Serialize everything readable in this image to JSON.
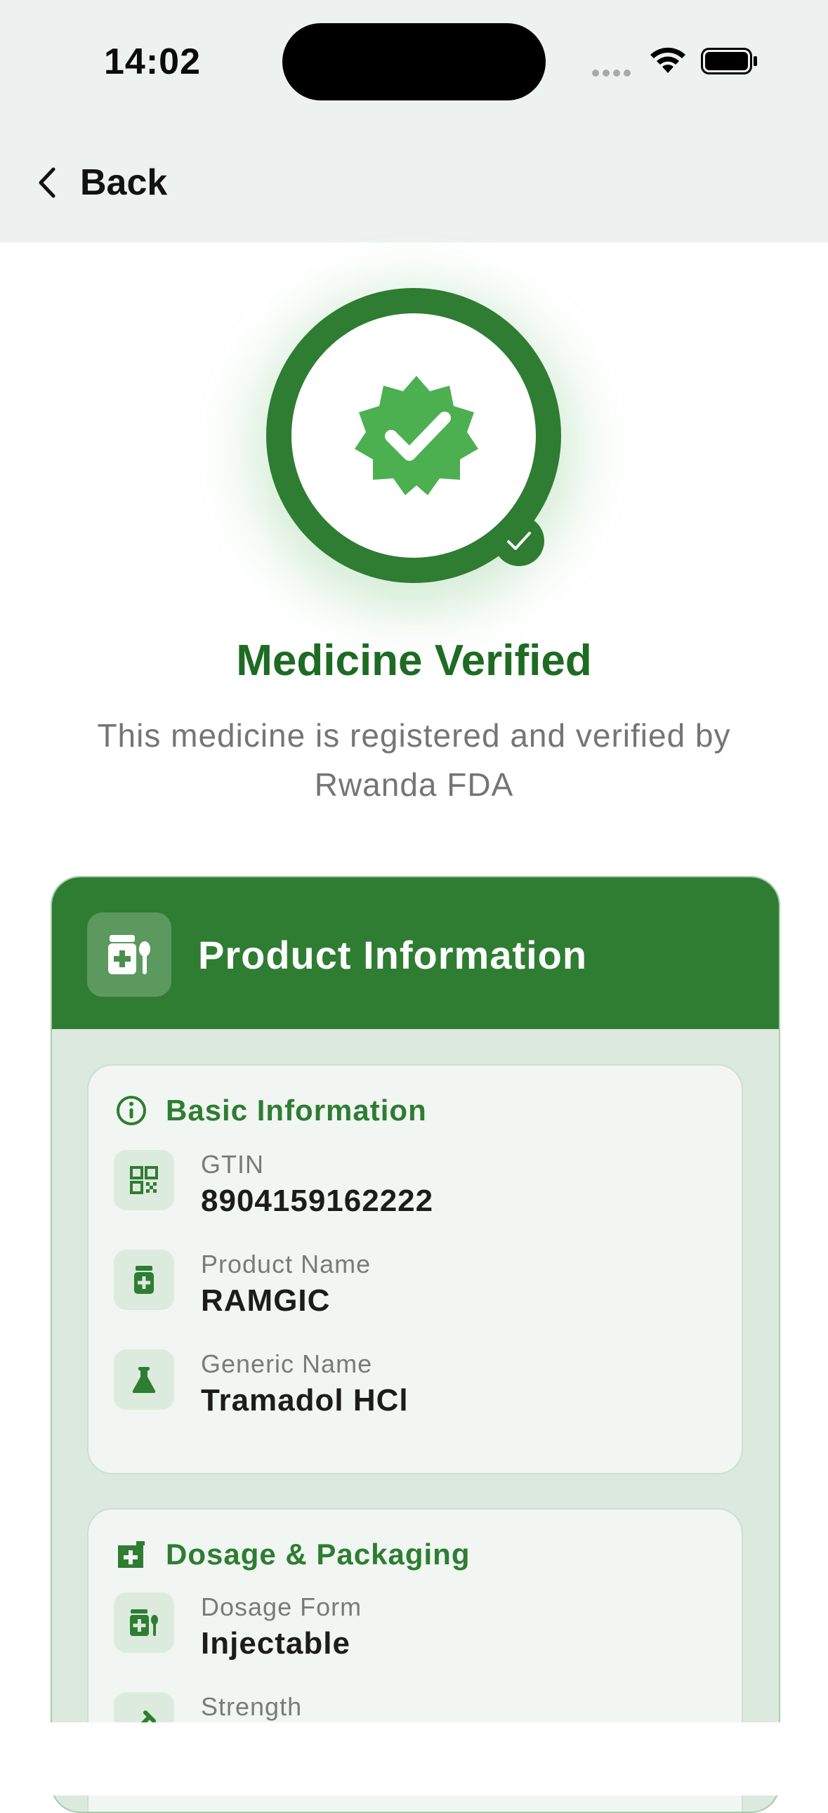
{
  "status_bar": {
    "time": "14:02"
  },
  "nav": {
    "back_label": "Back"
  },
  "verification": {
    "title": "Medicine Verified",
    "subtitle": "This medicine is registered and verified by Rwanda FDA"
  },
  "product_card": {
    "title": "Product Information",
    "sections": [
      {
        "title": "Basic Information",
        "icon": "info-icon",
        "rows": [
          {
            "label": "GTIN",
            "value": "8904159162222",
            "icon": "qr-code-icon"
          },
          {
            "label": "Product Name",
            "value": "RAMGIC",
            "icon": "medicine-bottle-icon"
          },
          {
            "label": "Generic Name",
            "value": "Tramadol HCl",
            "icon": "flask-icon"
          }
        ]
      },
      {
        "title": "Dosage & Packaging",
        "icon": "prescription-icon",
        "rows": [
          {
            "label": "Dosage Form",
            "value": "Injectable",
            "icon": "medication-icon"
          },
          {
            "label": "Strength",
            "value": "",
            "icon": "strength-icon"
          }
        ]
      }
    ]
  },
  "colors": {
    "primary": "#2e7d32",
    "title_green": "#1e6b23",
    "light_green": "#4caf50",
    "topbar_bg": "#edf2f0"
  }
}
